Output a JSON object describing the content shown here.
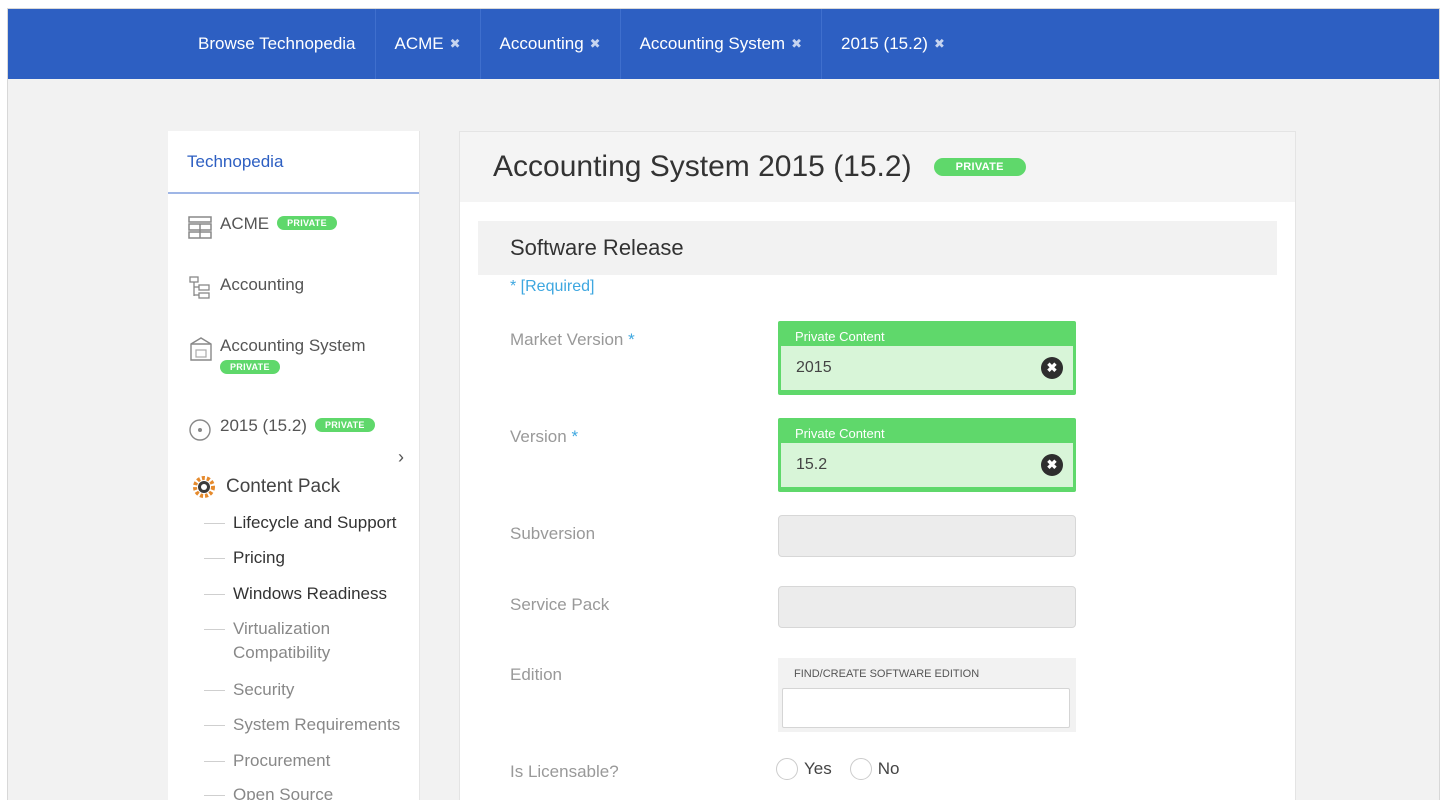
{
  "topbar": {
    "crumbs": [
      {
        "label": "Browse Technopedia",
        "close": ""
      },
      {
        "label": "ACME",
        "close": "✖"
      },
      {
        "label": "Accounting",
        "close": "✖"
      },
      {
        "label": "Accounting System",
        "close": "✖"
      },
      {
        "label": "2015 (15.2)",
        "close": "✖"
      }
    ]
  },
  "sidebar": {
    "header": "Technopedia",
    "items": [
      {
        "label": "ACME",
        "badge": "PRIVATE",
        "icon": "building-icon"
      },
      {
        "label": "Accounting",
        "badge": "",
        "icon": "hierarchy-icon"
      },
      {
        "label": "Accounting System",
        "badge": "PRIVATE",
        "icon": "box-icon"
      },
      {
        "label": "2015 (15.2)",
        "badge": "PRIVATE",
        "icon": "disc-icon"
      }
    ],
    "chevron": "›",
    "content_pack": {
      "label": "Content Pack",
      "icon": "gear-icon"
    },
    "sub_items": [
      {
        "label": "Lifecycle and Support",
        "tone": "dark"
      },
      {
        "label": "Pricing",
        "tone": "dark"
      },
      {
        "label": "Windows Readiness",
        "tone": "dark"
      },
      {
        "label": "Virtualization\nCompatibility",
        "tone": "light"
      },
      {
        "label": "Security",
        "tone": "light"
      },
      {
        "label": "System Requirements",
        "tone": "light"
      },
      {
        "label": "Procurement",
        "tone": "light"
      },
      {
        "label": "Open Source",
        "tone": "light"
      }
    ]
  },
  "main": {
    "title": "Accounting System 2015 (15.2)",
    "title_badge": "PRIVATE",
    "section": "Software Release",
    "required_note": "* [Required]",
    "fields": {
      "market_version": {
        "label": "Market Version",
        "required": "*",
        "caption": "Private Content",
        "value": "2015"
      },
      "version": {
        "label": "Version",
        "required": "*",
        "caption": "Private Content",
        "value": "15.2"
      },
      "subversion": {
        "label": "Subversion"
      },
      "service_pack": {
        "label": "Service Pack"
      },
      "edition": {
        "label": "Edition",
        "caption": "FIND/CREATE SOFTWARE EDITION"
      },
      "is_licensable": {
        "label": "Is Licensable?",
        "options": [
          "Yes",
          "No"
        ]
      }
    }
  },
  "colors": {
    "topbar": "#2d5fc2",
    "private_green": "#5fd86b",
    "link_blue": "#3ea7e0"
  }
}
